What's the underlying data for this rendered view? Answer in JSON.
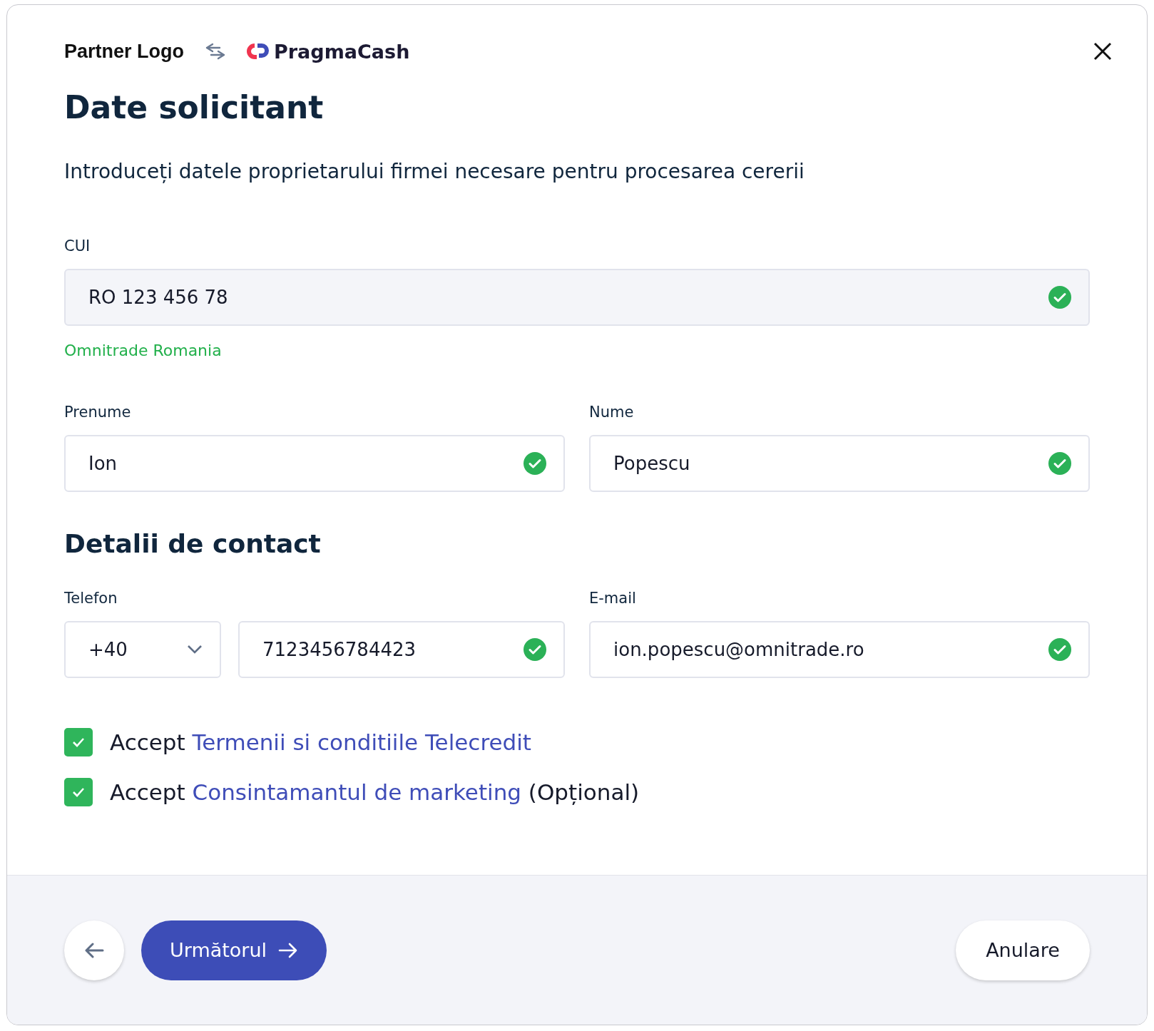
{
  "header": {
    "partner_logo": "Partner Logo",
    "brand": "PragmaCash"
  },
  "title": "Date solicitant",
  "subtitle": "Introduceți datele proprietarului firmei necesare pentru procesarea cererii",
  "cui": {
    "label": "CUI",
    "value": "RO 123 456 78",
    "valid": true,
    "disabled": true,
    "company": "Omnitrade Romania"
  },
  "name_fields": [
    {
      "label": "Prenume",
      "value": "Ion",
      "valid": true
    },
    {
      "label": "Nume",
      "value": "Popescu",
      "valid": true
    }
  ],
  "contact_heading": "Detalii de contact",
  "phone": {
    "label": "Telefon",
    "prefix": "+40",
    "value": "7123456784423",
    "valid": true
  },
  "email": {
    "label": "E-mail",
    "value": "ion.popescu@omnitrade.ro",
    "valid": true
  },
  "consents": [
    {
      "text": "Accept",
      "link": "Termenii si conditiile Telecredit",
      "checked": true
    },
    {
      "text": "Accept",
      "link": "Consintamantul de marketing",
      "suffix": "(Opțional)",
      "checked": true
    }
  ],
  "footer": {
    "next": "Următorul",
    "cancel": "Anulare"
  }
}
